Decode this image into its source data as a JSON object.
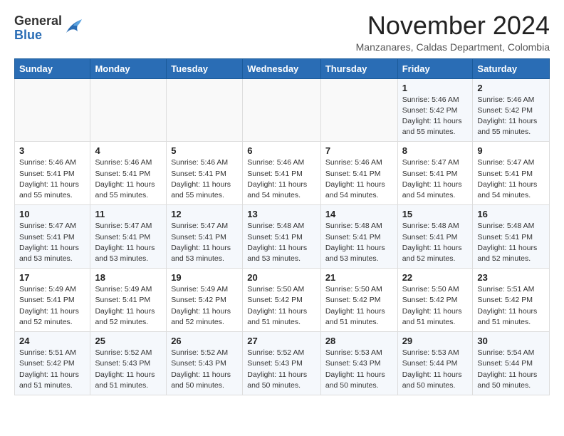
{
  "logo": {
    "general": "General",
    "blue": "Blue"
  },
  "title": "November 2024",
  "subtitle": "Manzanares, Caldas Department, Colombia",
  "weekdays": [
    "Sunday",
    "Monday",
    "Tuesday",
    "Wednesday",
    "Thursday",
    "Friday",
    "Saturday"
  ],
  "weeks": [
    [
      {
        "day": "",
        "info": ""
      },
      {
        "day": "",
        "info": ""
      },
      {
        "day": "",
        "info": ""
      },
      {
        "day": "",
        "info": ""
      },
      {
        "day": "",
        "info": ""
      },
      {
        "day": "1",
        "info": "Sunrise: 5:46 AM\nSunset: 5:42 PM\nDaylight: 11 hours\nand 55 minutes."
      },
      {
        "day": "2",
        "info": "Sunrise: 5:46 AM\nSunset: 5:42 PM\nDaylight: 11 hours\nand 55 minutes."
      }
    ],
    [
      {
        "day": "3",
        "info": "Sunrise: 5:46 AM\nSunset: 5:41 PM\nDaylight: 11 hours\nand 55 minutes."
      },
      {
        "day": "4",
        "info": "Sunrise: 5:46 AM\nSunset: 5:41 PM\nDaylight: 11 hours\nand 55 minutes."
      },
      {
        "day": "5",
        "info": "Sunrise: 5:46 AM\nSunset: 5:41 PM\nDaylight: 11 hours\nand 55 minutes."
      },
      {
        "day": "6",
        "info": "Sunrise: 5:46 AM\nSunset: 5:41 PM\nDaylight: 11 hours\nand 54 minutes."
      },
      {
        "day": "7",
        "info": "Sunrise: 5:46 AM\nSunset: 5:41 PM\nDaylight: 11 hours\nand 54 minutes."
      },
      {
        "day": "8",
        "info": "Sunrise: 5:47 AM\nSunset: 5:41 PM\nDaylight: 11 hours\nand 54 minutes."
      },
      {
        "day": "9",
        "info": "Sunrise: 5:47 AM\nSunset: 5:41 PM\nDaylight: 11 hours\nand 54 minutes."
      }
    ],
    [
      {
        "day": "10",
        "info": "Sunrise: 5:47 AM\nSunset: 5:41 PM\nDaylight: 11 hours\nand 53 minutes."
      },
      {
        "day": "11",
        "info": "Sunrise: 5:47 AM\nSunset: 5:41 PM\nDaylight: 11 hours\nand 53 minutes."
      },
      {
        "day": "12",
        "info": "Sunrise: 5:47 AM\nSunset: 5:41 PM\nDaylight: 11 hours\nand 53 minutes."
      },
      {
        "day": "13",
        "info": "Sunrise: 5:48 AM\nSunset: 5:41 PM\nDaylight: 11 hours\nand 53 minutes."
      },
      {
        "day": "14",
        "info": "Sunrise: 5:48 AM\nSunset: 5:41 PM\nDaylight: 11 hours\nand 53 minutes."
      },
      {
        "day": "15",
        "info": "Sunrise: 5:48 AM\nSunset: 5:41 PM\nDaylight: 11 hours\nand 52 minutes."
      },
      {
        "day": "16",
        "info": "Sunrise: 5:48 AM\nSunset: 5:41 PM\nDaylight: 11 hours\nand 52 minutes."
      }
    ],
    [
      {
        "day": "17",
        "info": "Sunrise: 5:49 AM\nSunset: 5:41 PM\nDaylight: 11 hours\nand 52 minutes."
      },
      {
        "day": "18",
        "info": "Sunrise: 5:49 AM\nSunset: 5:41 PM\nDaylight: 11 hours\nand 52 minutes."
      },
      {
        "day": "19",
        "info": "Sunrise: 5:49 AM\nSunset: 5:42 PM\nDaylight: 11 hours\nand 52 minutes."
      },
      {
        "day": "20",
        "info": "Sunrise: 5:50 AM\nSunset: 5:42 PM\nDaylight: 11 hours\nand 51 minutes."
      },
      {
        "day": "21",
        "info": "Sunrise: 5:50 AM\nSunset: 5:42 PM\nDaylight: 11 hours\nand 51 minutes."
      },
      {
        "day": "22",
        "info": "Sunrise: 5:50 AM\nSunset: 5:42 PM\nDaylight: 11 hours\nand 51 minutes."
      },
      {
        "day": "23",
        "info": "Sunrise: 5:51 AM\nSunset: 5:42 PM\nDaylight: 11 hours\nand 51 minutes."
      }
    ],
    [
      {
        "day": "24",
        "info": "Sunrise: 5:51 AM\nSunset: 5:42 PM\nDaylight: 11 hours\nand 51 minutes."
      },
      {
        "day": "25",
        "info": "Sunrise: 5:52 AM\nSunset: 5:43 PM\nDaylight: 11 hours\nand 51 minutes."
      },
      {
        "day": "26",
        "info": "Sunrise: 5:52 AM\nSunset: 5:43 PM\nDaylight: 11 hours\nand 50 minutes."
      },
      {
        "day": "27",
        "info": "Sunrise: 5:52 AM\nSunset: 5:43 PM\nDaylight: 11 hours\nand 50 minutes."
      },
      {
        "day": "28",
        "info": "Sunrise: 5:53 AM\nSunset: 5:43 PM\nDaylight: 11 hours\nand 50 minutes."
      },
      {
        "day": "29",
        "info": "Sunrise: 5:53 AM\nSunset: 5:44 PM\nDaylight: 11 hours\nand 50 minutes."
      },
      {
        "day": "30",
        "info": "Sunrise: 5:54 AM\nSunset: 5:44 PM\nDaylight: 11 hours\nand 50 minutes."
      }
    ]
  ]
}
